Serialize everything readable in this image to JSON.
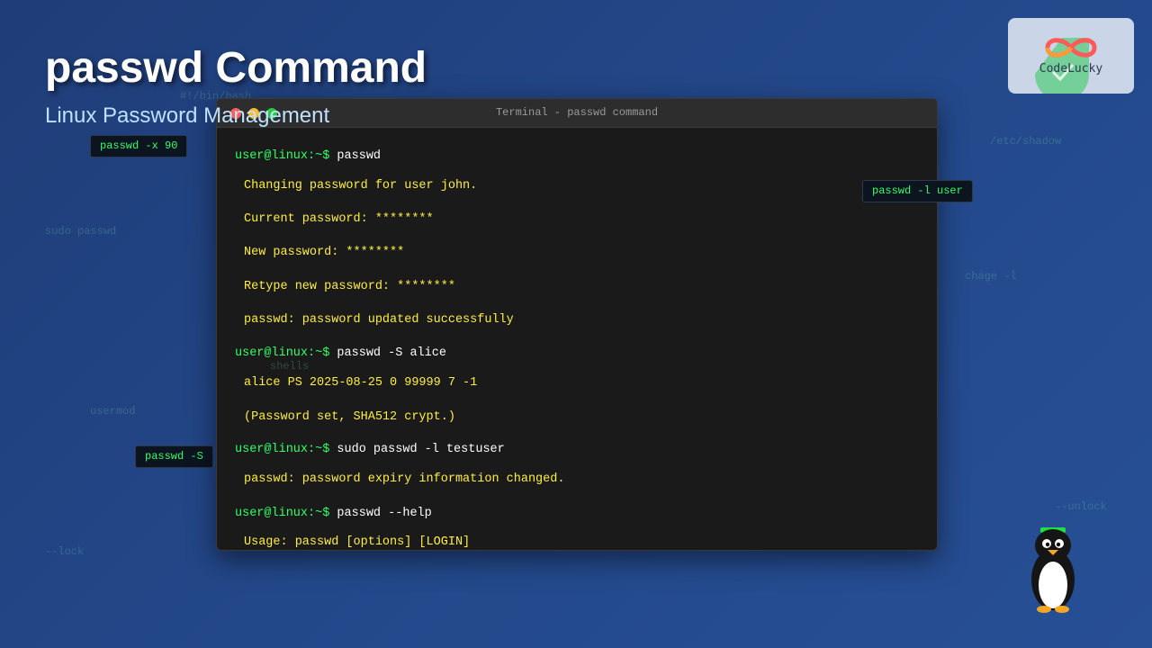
{
  "header": {
    "title": "passwd Command",
    "subtitle": "Linux Password Management"
  },
  "background_snippets": [
    "#!/bin/bash",
    "/etc/shadow",
    "sudo passwd",
    "chage -l",
    "shells",
    "usermod",
    "--unlock",
    "--lock"
  ],
  "floating_chips": [
    "passwd -x 90",
    "passwd -l user",
    "passwd -S"
  ],
  "terminal": {
    "title": "Terminal - passwd command",
    "lines": [
      {
        "type": "cmd",
        "prompt": "user@linux:~$",
        "text": " passwd"
      },
      {
        "type": "out",
        "text": "Changing password for user john."
      },
      {
        "type": "out",
        "text": "Current password: ********"
      },
      {
        "type": "out",
        "text": "New password: ********"
      },
      {
        "type": "out",
        "text": "Retype new password: ********"
      },
      {
        "type": "out",
        "text": "passwd: password updated successfully"
      },
      {
        "type": "cmd",
        "prompt": "user@linux:~$",
        "text": " passwd -S alice"
      },
      {
        "type": "out",
        "text": "alice PS 2025-08-25 0 99999 7 -1"
      },
      {
        "type": "out",
        "text": "(Password set, SHA512 crypt.)"
      },
      {
        "type": "cmd",
        "prompt": "user@linux:~$",
        "text": " sudo passwd -l testuser"
      },
      {
        "type": "out",
        "text": "passwd: password expiry information changed."
      },
      {
        "type": "cmd",
        "prompt": "user@linux:~$",
        "text": " passwd --help"
      },
      {
        "type": "out",
        "text": "Usage: passwd [options] [LOGIN]"
      }
    ]
  },
  "logo": {
    "text": "CodeLucky",
    "icon": "infinity-logo-icon"
  },
  "mascot": {
    "icon": "tux-penguin-icon"
  },
  "colors": {
    "prompt": "#33ff66",
    "command": "#ffffff",
    "output": "#ffee44",
    "terminal_bg": "#1a1a1a",
    "background": "#23488a"
  }
}
